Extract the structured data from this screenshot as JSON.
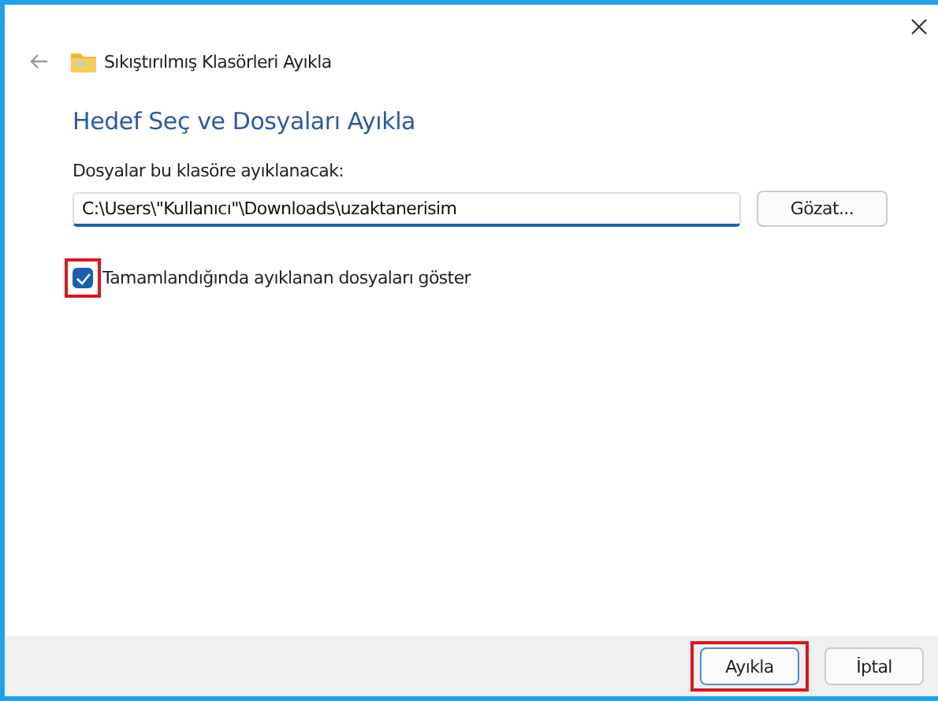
{
  "window": {
    "title": "Sıkıştırılmış Klasörleri Ayıkla"
  },
  "heading": "Hedef Seç ve Dosyaları Ayıkla",
  "destination": {
    "label": "Dosyalar bu klasöre ayıklanacak:",
    "value": "C:\\Users\\\"Kullanıcı\"\\Downloads\\uzaktanerisim",
    "browse": "Gözat..."
  },
  "show_files": {
    "label": "Tamamlandığında ayıklanan dosyaları göster",
    "checked": true,
    "highlighted": true
  },
  "buttons": [
    {
      "label": "Ayıkla",
      "kind": "primary",
      "highlighted": true
    },
    {
      "label": "İptal",
      "kind": "secondary",
      "highlighted": false
    }
  ]
}
